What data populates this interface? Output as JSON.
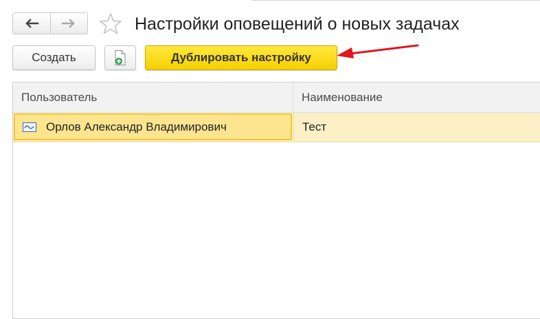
{
  "header": {
    "title": "Настройки оповещений о новых задачах"
  },
  "toolbar": {
    "create_label": "Создать",
    "duplicate_label": "Дублировать настройку"
  },
  "colors": {
    "accent_button": "#f5cf00",
    "annotation_arrow": "#e0181b",
    "selected_row": "#fbf0c6"
  },
  "icons": {
    "back": "arrow-left-icon",
    "forward": "arrow-right-icon",
    "favorite": "star-outline-icon",
    "add": "add-document-icon",
    "row": "record-icon"
  },
  "table": {
    "columns": [
      "Пользователь",
      "Наименование"
    ],
    "rows": [
      {
        "user": "Орлов Александр Владимирович",
        "name": "Тест"
      }
    ]
  }
}
